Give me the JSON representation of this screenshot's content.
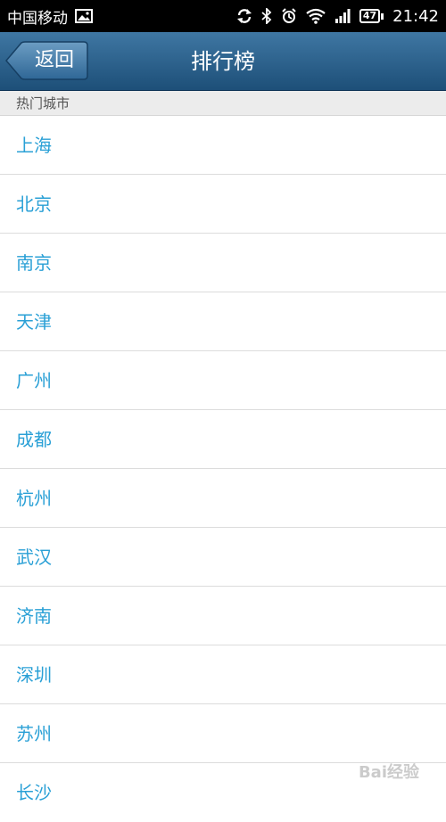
{
  "status_bar": {
    "carrier": "中国移动",
    "battery": "47",
    "time": "21:42"
  },
  "header": {
    "back_label": "返回",
    "title": "排行榜"
  },
  "section_header": "热门城市",
  "cities": [
    "上海",
    "北京",
    "南京",
    "天津",
    "广州",
    "成都",
    "杭州",
    "武汉",
    "济南",
    "深圳",
    "苏州",
    "长沙"
  ],
  "watermark": "Bai经验",
  "colors": {
    "title_bar": "#2a5f8a",
    "city_text": "#2aa0d6",
    "section_bg": "#ececec"
  }
}
